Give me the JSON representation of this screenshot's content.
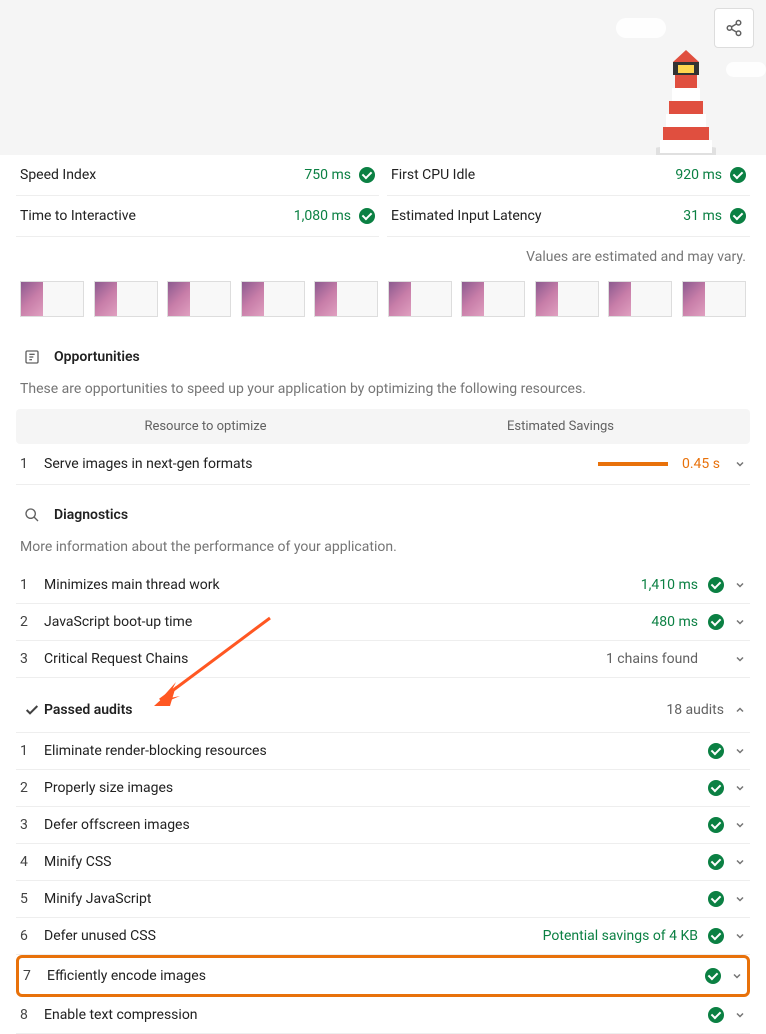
{
  "metrics": {
    "left": [
      {
        "label": "Speed Index",
        "value": "750 ms"
      },
      {
        "label": "Time to Interactive",
        "value": "1,080 ms"
      }
    ],
    "right": [
      {
        "label": "First CPU Idle",
        "value": "920 ms"
      },
      {
        "label": "Estimated Input Latency",
        "value": "31 ms"
      }
    ]
  },
  "estimate_note": "Values are estimated and may vary.",
  "opportunities": {
    "title": "Opportunities",
    "desc": "These are opportunities to speed up your application by optimizing the following resources.",
    "col_left": "Resource to optimize",
    "col_right": "Estimated Savings",
    "rows": [
      {
        "num": "1",
        "label": "Serve images in next-gen formats",
        "value": "0.45 s"
      }
    ]
  },
  "diagnostics": {
    "title": "Diagnostics",
    "desc": "More information about the performance of your application.",
    "rows": [
      {
        "num": "1",
        "label": "Minimizes main thread work",
        "value": "1,410 ms",
        "pass": true
      },
      {
        "num": "2",
        "label": "JavaScript boot-up time",
        "value": "480 ms",
        "pass": true
      },
      {
        "num": "3",
        "label": "Critical Request Chains",
        "value": "1 chains found",
        "pass": false
      }
    ]
  },
  "passed": {
    "title": "Passed audits",
    "count": "18 audits",
    "rows": [
      {
        "num": "1",
        "label": "Eliminate render-blocking resources",
        "highlight": false
      },
      {
        "num": "2",
        "label": "Properly size images",
        "highlight": false
      },
      {
        "num": "3",
        "label": "Defer offscreen images",
        "highlight": false
      },
      {
        "num": "4",
        "label": "Minify CSS",
        "highlight": false
      },
      {
        "num": "5",
        "label": "Minify JavaScript",
        "highlight": false
      },
      {
        "num": "6",
        "label": "Defer unused CSS",
        "extra": "Potential savings of 4 KB",
        "highlight": false
      },
      {
        "num": "7",
        "label": "Efficiently encode images",
        "highlight": true
      },
      {
        "num": "8",
        "label": "Enable text compression",
        "highlight": false
      }
    ]
  },
  "filmstrip_count": 10
}
